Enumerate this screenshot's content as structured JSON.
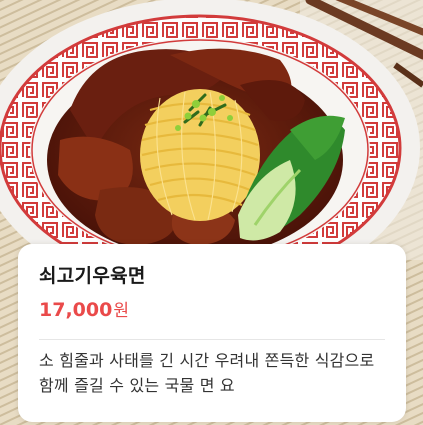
{
  "menu_item": {
    "name": "쇠고기우육면",
    "price_amount": "17,000",
    "price_unit": "원",
    "description": "소 힘줄과 사태를 긴 시간 우려내 쫀득한 식감으로 함께 즐길 수 있는 국물 면 요"
  },
  "colors": {
    "price": "#ea4a4a",
    "title": "#1a1a1a",
    "card_background": "#ffffff",
    "bowl_rim": "#d23b3b"
  }
}
